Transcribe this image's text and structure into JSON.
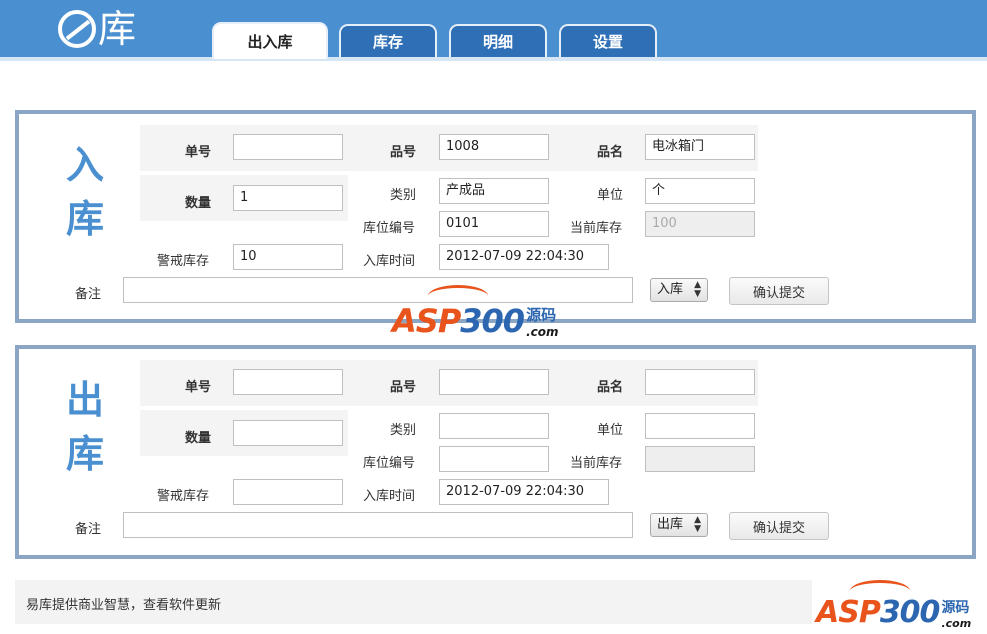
{
  "app": {
    "logo_text": "库"
  },
  "tabs": [
    {
      "label": "出入库",
      "active": true
    },
    {
      "label": "库存",
      "active": false
    },
    {
      "label": "明细",
      "active": false
    },
    {
      "label": "设置",
      "active": false
    }
  ],
  "colors": {
    "header": "#4a8fd0",
    "tab_inactive": "#2f6fb6",
    "panel_border": "#8aa6c4",
    "title_blue": "#4a8fd0"
  },
  "inbound": {
    "title_1": "入",
    "title_2": "库",
    "labels": {
      "order_no": "单号",
      "product_no": "品号",
      "product_name": "品名",
      "quantity": "数量",
      "category": "类别",
      "unit": "单位",
      "location_no": "库位编号",
      "current_stock": "当前库存",
      "alert_stock": "警戒库存",
      "in_time": "入库时间",
      "remark": "备注"
    },
    "values": {
      "order_no": "",
      "product_no": "1008",
      "product_name": "电冰箱门",
      "quantity": "1",
      "category": "产成品",
      "unit": "个",
      "location_no": "0101",
      "current_stock": "100",
      "alert_stock": "10",
      "in_time": "2012-07-09 22:04:30",
      "remark": ""
    },
    "mode_select": "入库",
    "submit_label": "确认提交"
  },
  "outbound": {
    "title_1": "出",
    "title_2": "库",
    "labels": {
      "order_no": "单号",
      "product_no": "品号",
      "product_name": "品名",
      "quantity": "数量",
      "category": "类别",
      "unit": "单位",
      "location_no": "库位编号",
      "current_stock": "当前库存",
      "alert_stock": "警戒库存",
      "in_time": "入库时间",
      "remark": "备注"
    },
    "values": {
      "order_no": "",
      "product_no": "",
      "product_name": "",
      "quantity": "",
      "category": "",
      "unit": "",
      "location_no": "",
      "current_stock": "",
      "alert_stock": "",
      "in_time": "2012-07-09 22:04:30",
      "remark": ""
    },
    "mode_select": "出库",
    "submit_label": "确认提交"
  },
  "watermark": {
    "main_orange": "ASP",
    "main_blue": "300",
    "cn": "源码",
    "com": ".com"
  },
  "footer": {
    "text": "易库提供商业智慧，查看软件更新"
  }
}
